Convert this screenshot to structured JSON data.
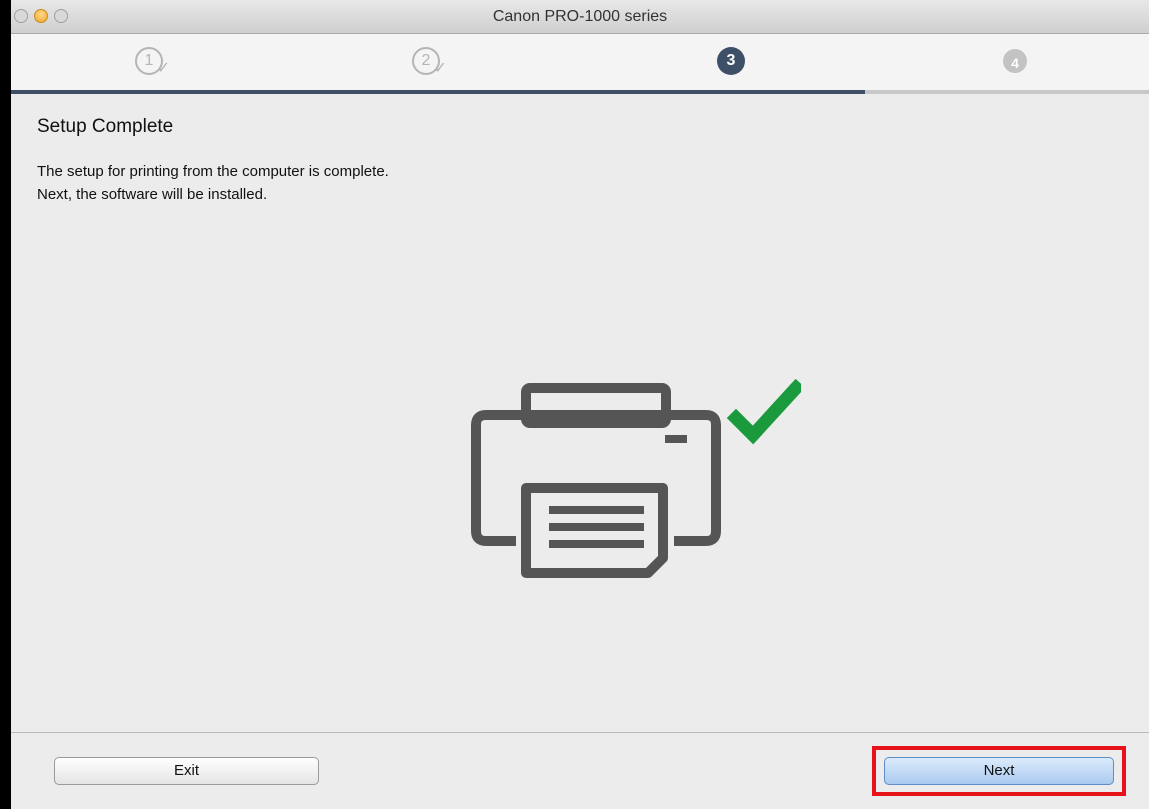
{
  "window": {
    "title": "Canon PRO-1000 series"
  },
  "steps": [
    {
      "label": "1",
      "state": "completed"
    },
    {
      "label": "2",
      "state": "completed"
    },
    {
      "label": "3",
      "state": "current"
    },
    {
      "label": "4",
      "state": "upcoming"
    }
  ],
  "progress": {
    "completed_steps": 3,
    "total_steps": 4
  },
  "main": {
    "heading": "Setup Complete",
    "lines": [
      "The setup for printing from the computer is complete.",
      "Next, the software will be installed."
    ],
    "illustration": {
      "icon": "printer-icon",
      "status_icon": "checkmark-icon",
      "check_color": "#1a9a3c",
      "printer_color": "#555555"
    }
  },
  "footer": {
    "exit_label": "Exit",
    "next_label": "Next"
  },
  "colors": {
    "accent": "#3e4f68",
    "highlight": "#e8131a"
  }
}
